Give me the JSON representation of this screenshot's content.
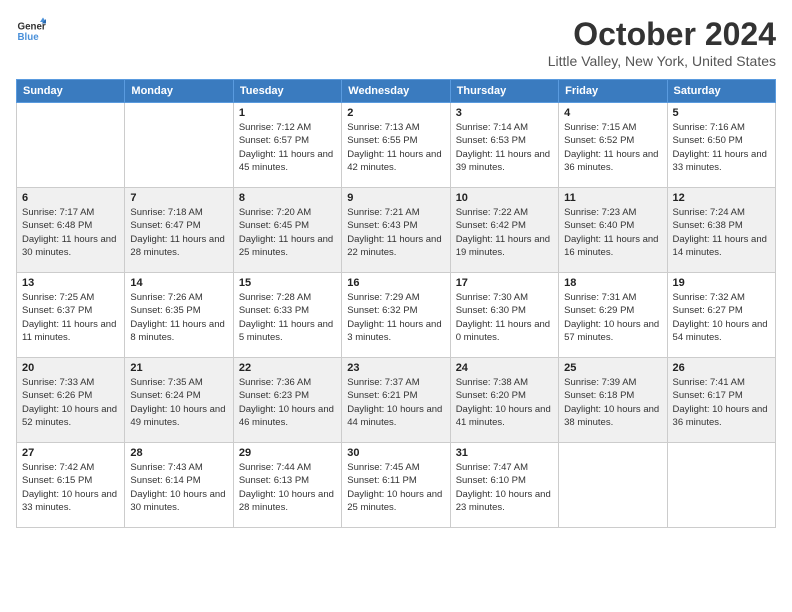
{
  "logo": {
    "line1": "General",
    "line2": "Blue"
  },
  "title": "October 2024",
  "location": "Little Valley, New York, United States",
  "headers": [
    "Sunday",
    "Monday",
    "Tuesday",
    "Wednesday",
    "Thursday",
    "Friday",
    "Saturday"
  ],
  "weeks": [
    [
      {
        "day": "",
        "info": ""
      },
      {
        "day": "",
        "info": ""
      },
      {
        "day": "1",
        "info": "Sunrise: 7:12 AM\nSunset: 6:57 PM\nDaylight: 11 hours and 45 minutes."
      },
      {
        "day": "2",
        "info": "Sunrise: 7:13 AM\nSunset: 6:55 PM\nDaylight: 11 hours and 42 minutes."
      },
      {
        "day": "3",
        "info": "Sunrise: 7:14 AM\nSunset: 6:53 PM\nDaylight: 11 hours and 39 minutes."
      },
      {
        "day": "4",
        "info": "Sunrise: 7:15 AM\nSunset: 6:52 PM\nDaylight: 11 hours and 36 minutes."
      },
      {
        "day": "5",
        "info": "Sunrise: 7:16 AM\nSunset: 6:50 PM\nDaylight: 11 hours and 33 minutes."
      }
    ],
    [
      {
        "day": "6",
        "info": "Sunrise: 7:17 AM\nSunset: 6:48 PM\nDaylight: 11 hours and 30 minutes."
      },
      {
        "day": "7",
        "info": "Sunrise: 7:18 AM\nSunset: 6:47 PM\nDaylight: 11 hours and 28 minutes."
      },
      {
        "day": "8",
        "info": "Sunrise: 7:20 AM\nSunset: 6:45 PM\nDaylight: 11 hours and 25 minutes."
      },
      {
        "day": "9",
        "info": "Sunrise: 7:21 AM\nSunset: 6:43 PM\nDaylight: 11 hours and 22 minutes."
      },
      {
        "day": "10",
        "info": "Sunrise: 7:22 AM\nSunset: 6:42 PM\nDaylight: 11 hours and 19 minutes."
      },
      {
        "day": "11",
        "info": "Sunrise: 7:23 AM\nSunset: 6:40 PM\nDaylight: 11 hours and 16 minutes."
      },
      {
        "day": "12",
        "info": "Sunrise: 7:24 AM\nSunset: 6:38 PM\nDaylight: 11 hours and 14 minutes."
      }
    ],
    [
      {
        "day": "13",
        "info": "Sunrise: 7:25 AM\nSunset: 6:37 PM\nDaylight: 11 hours and 11 minutes."
      },
      {
        "day": "14",
        "info": "Sunrise: 7:26 AM\nSunset: 6:35 PM\nDaylight: 11 hours and 8 minutes."
      },
      {
        "day": "15",
        "info": "Sunrise: 7:28 AM\nSunset: 6:33 PM\nDaylight: 11 hours and 5 minutes."
      },
      {
        "day": "16",
        "info": "Sunrise: 7:29 AM\nSunset: 6:32 PM\nDaylight: 11 hours and 3 minutes."
      },
      {
        "day": "17",
        "info": "Sunrise: 7:30 AM\nSunset: 6:30 PM\nDaylight: 11 hours and 0 minutes."
      },
      {
        "day": "18",
        "info": "Sunrise: 7:31 AM\nSunset: 6:29 PM\nDaylight: 10 hours and 57 minutes."
      },
      {
        "day": "19",
        "info": "Sunrise: 7:32 AM\nSunset: 6:27 PM\nDaylight: 10 hours and 54 minutes."
      }
    ],
    [
      {
        "day": "20",
        "info": "Sunrise: 7:33 AM\nSunset: 6:26 PM\nDaylight: 10 hours and 52 minutes."
      },
      {
        "day": "21",
        "info": "Sunrise: 7:35 AM\nSunset: 6:24 PM\nDaylight: 10 hours and 49 minutes."
      },
      {
        "day": "22",
        "info": "Sunrise: 7:36 AM\nSunset: 6:23 PM\nDaylight: 10 hours and 46 minutes."
      },
      {
        "day": "23",
        "info": "Sunrise: 7:37 AM\nSunset: 6:21 PM\nDaylight: 10 hours and 44 minutes."
      },
      {
        "day": "24",
        "info": "Sunrise: 7:38 AM\nSunset: 6:20 PM\nDaylight: 10 hours and 41 minutes."
      },
      {
        "day": "25",
        "info": "Sunrise: 7:39 AM\nSunset: 6:18 PM\nDaylight: 10 hours and 38 minutes."
      },
      {
        "day": "26",
        "info": "Sunrise: 7:41 AM\nSunset: 6:17 PM\nDaylight: 10 hours and 36 minutes."
      }
    ],
    [
      {
        "day": "27",
        "info": "Sunrise: 7:42 AM\nSunset: 6:15 PM\nDaylight: 10 hours and 33 minutes."
      },
      {
        "day": "28",
        "info": "Sunrise: 7:43 AM\nSunset: 6:14 PM\nDaylight: 10 hours and 30 minutes."
      },
      {
        "day": "29",
        "info": "Sunrise: 7:44 AM\nSunset: 6:13 PM\nDaylight: 10 hours and 28 minutes."
      },
      {
        "day": "30",
        "info": "Sunrise: 7:45 AM\nSunset: 6:11 PM\nDaylight: 10 hours and 25 minutes."
      },
      {
        "day": "31",
        "info": "Sunrise: 7:47 AM\nSunset: 6:10 PM\nDaylight: 10 hours and 23 minutes."
      },
      {
        "day": "",
        "info": ""
      },
      {
        "day": "",
        "info": ""
      }
    ]
  ]
}
